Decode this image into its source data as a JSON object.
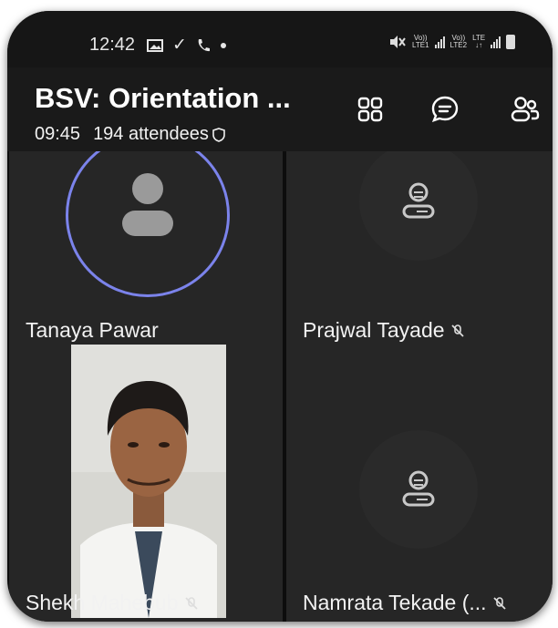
{
  "status_bar": {
    "time": "12:42",
    "lte1_a": "Vo))",
    "lte1_b": "LTE1",
    "lte2_a": "Vo))",
    "lte2_b": "LTE2",
    "lte_badge": "LTE"
  },
  "meeting": {
    "title": "BSV: Orientation ...",
    "elapsed": "09:45",
    "attendees": "194 attendees"
  },
  "participants": [
    {
      "name": "Tanaya Pawar"
    },
    {
      "name": "Prajwal Tayade"
    },
    {
      "name": "Shekh Mahebub"
    },
    {
      "name": "Namrata  Tekade (..."
    }
  ],
  "colors": {
    "speaking_ring": "#7b83eb",
    "background": "#0d0d0d",
    "tile": "#262626"
  },
  "icons": [
    "gallery-icon",
    "check-icon",
    "phone-icon",
    "dot-icon",
    "mute-icon",
    "grid-view-icon",
    "chat-icon",
    "participants-icon",
    "shield-icon",
    "mic-off-icon",
    "phone-user-icon",
    "person-icon"
  ]
}
